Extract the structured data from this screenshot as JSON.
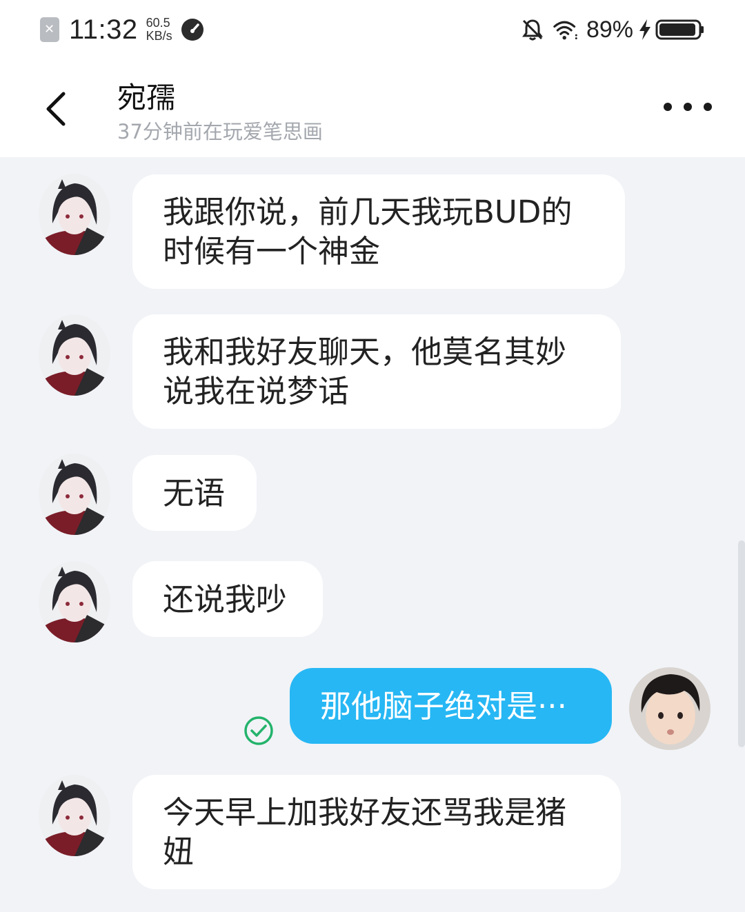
{
  "status_bar": {
    "time": "11:32",
    "net_speed_value": "60.5",
    "net_speed_unit": "KB/s",
    "battery_percent": "89%",
    "icons": [
      "notification-dismiss-icon",
      "speed-gauge-icon",
      "mute-bell-icon",
      "wifi-icon",
      "charging-bolt-icon",
      "battery-icon"
    ]
  },
  "header": {
    "contact_name": "宛孺",
    "contact_status": "37分钟前在玩爱笔思画"
  },
  "messages": [
    {
      "from": "contact",
      "text": "我跟你说，前几天我玩BUD的时候有一个神金"
    },
    {
      "from": "contact",
      "text": "我和我好友聊天，他莫名其妙说我在说梦话"
    },
    {
      "from": "contact",
      "text": "无语"
    },
    {
      "from": "contact",
      "text": "还说我吵"
    },
    {
      "from": "me",
      "text": "那他脑子绝对是···",
      "status": "read"
    },
    {
      "from": "contact",
      "text": "今天早上加我好友还骂我是猪妞"
    }
  ],
  "colors": {
    "background": "#f1f3f7",
    "incoming_bubble": "#ffffff",
    "outgoing_bubble": "#27b7f4",
    "read_check": "#23b36b",
    "secondary_text": "#a4a8ae"
  }
}
